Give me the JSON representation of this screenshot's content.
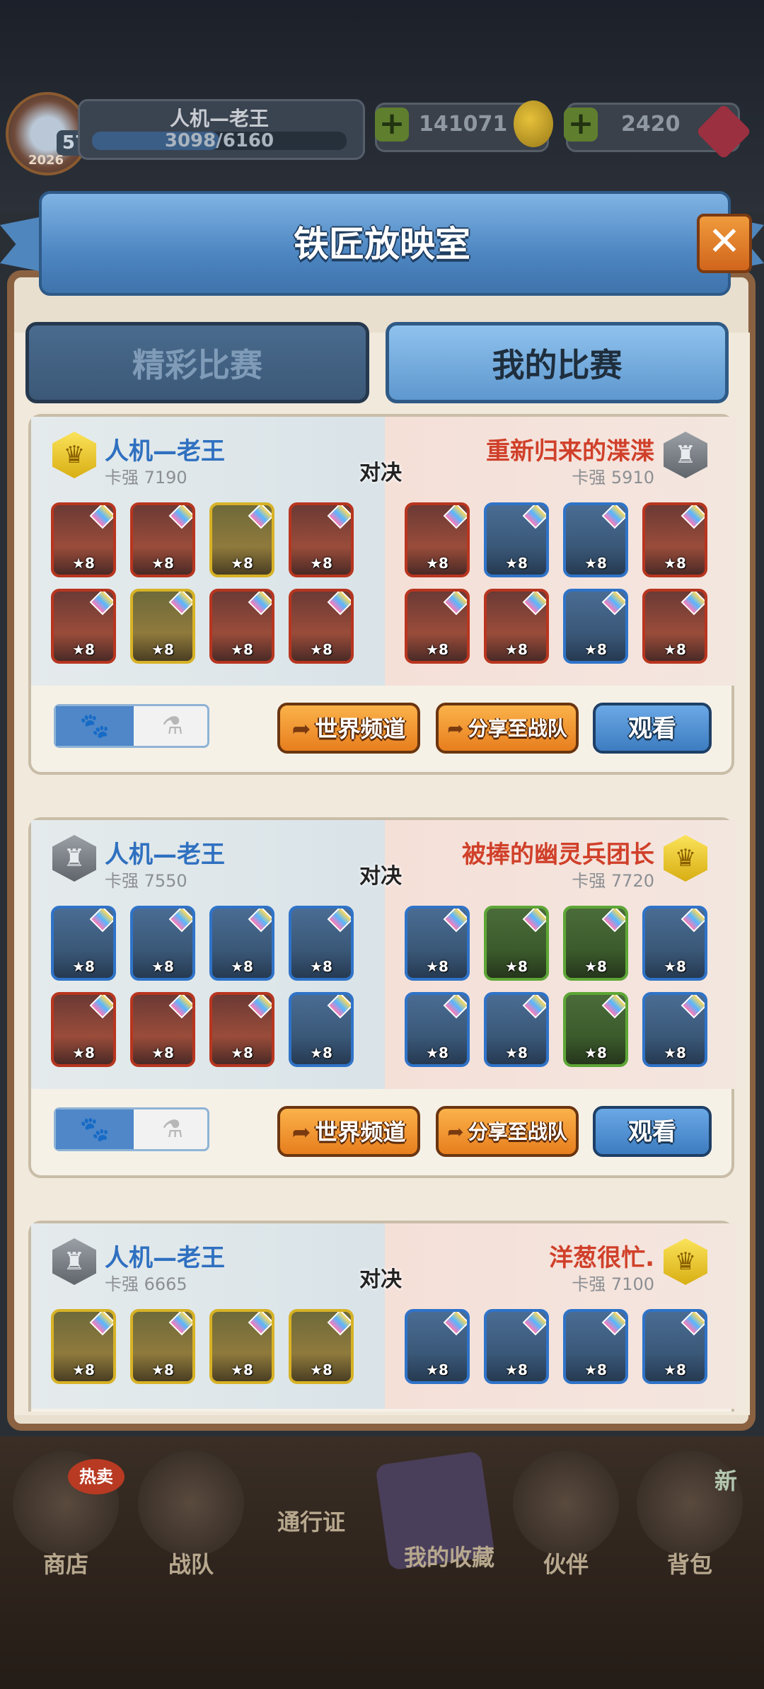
{
  "header": {
    "player_name": "人机—老王",
    "level": "57",
    "year_badge": "2026",
    "exp": "3098/6160",
    "gold": "141071",
    "gems": "2420"
  },
  "dialog": {
    "title": "铁匠放映室",
    "close_icon": "close-icon",
    "tabs": [
      "精彩比赛",
      "我的比赛"
    ],
    "active_tab": 1
  },
  "matches": [
    {
      "left": {
        "name": "人机—老王",
        "power": "卡强 7190",
        "badge": "gold",
        "heroes": [
          "red",
          "red",
          "yel",
          "red",
          "red",
          "yel",
          "red",
          "red"
        ]
      },
      "vs": "对决",
      "right": {
        "name": "重新归来的渫渫",
        "power": "卡强 5910",
        "badge": "silver",
        "heroes": [
          "red",
          "blu",
          "blu",
          "red",
          "red",
          "red",
          "blu",
          "red"
        ]
      },
      "buttons": {
        "world": "世界频道",
        "share": "分享至战队",
        "watch": "观看"
      }
    },
    {
      "left": {
        "name": "人机—老王",
        "power": "卡强 7550",
        "badge": "silver",
        "heroes": [
          "blu",
          "blu",
          "blu",
          "blu",
          "red",
          "red",
          "red",
          "blu"
        ]
      },
      "vs": "对决",
      "right": {
        "name": "被捧的幽灵兵团长",
        "power": "卡强 7720",
        "badge": "gold",
        "heroes": [
          "blu",
          "grn",
          "grn",
          "blu",
          "blu",
          "blu",
          "grn",
          "blu"
        ]
      },
      "buttons": {
        "world": "世界频道",
        "share": "分享至战队",
        "watch": "观看"
      }
    },
    {
      "left": {
        "name": "人机—老王",
        "power": "卡强 6665",
        "badge": "silver",
        "heroes": [
          "yel",
          "yel",
          "yel",
          "yel"
        ]
      },
      "vs": "对决",
      "right": {
        "name": "洋葱很忙.",
        "power": "卡强 7100",
        "badge": "gold",
        "heroes": [
          "blu",
          "blu",
          "blu",
          "blu"
        ]
      }
    }
  ],
  "hero_star": "★8",
  "nav": {
    "shop": "商店",
    "shop_tag": "热卖",
    "team": "战队",
    "pass": "通行证",
    "collection": "我的收藏",
    "partner": "伙伴",
    "bag": "背包",
    "bag_tag": "新"
  }
}
